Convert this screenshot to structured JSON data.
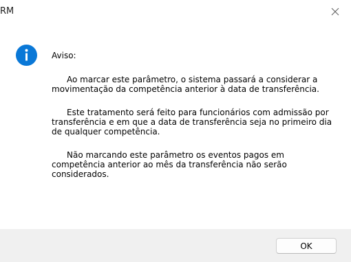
{
  "window": {
    "title": "RM",
    "close_icon": "close-icon"
  },
  "message": {
    "icon": "info-icon",
    "heading": "Aviso:",
    "paragraphs": [
      "Ao marcar este parâmetro, o sistema passará a considerar a movimentação da competência anterior à data de transferência.",
      "Este tratamento será feito para funcionários com admissão por transferência e em que a data de transferência seja no primeiro dia de qualquer competência.",
      "Não marcando este parâmetro os eventos pagos em competência anterior ao mês da transferência não serão considerados."
    ]
  },
  "buttons": {
    "ok_label": "OK"
  },
  "colors": {
    "info_icon_fill": "#0a78d7",
    "footer_bg": "#f0f0f0"
  }
}
